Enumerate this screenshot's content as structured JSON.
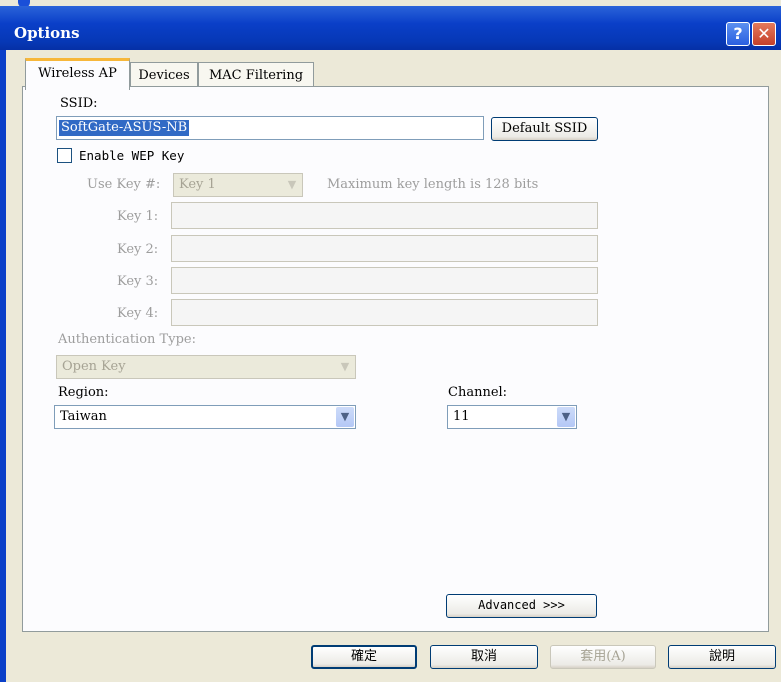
{
  "window": {
    "title": "Options",
    "help_glyph": "?",
    "close_glyph": "✕"
  },
  "tabs": [
    {
      "label": "Wireless AP",
      "active": true
    },
    {
      "label": "Devices",
      "active": false
    },
    {
      "label": "MAC Filtering",
      "active": false
    }
  ],
  "ssid": {
    "label": "SSID:",
    "value": "SoftGate-ASUS-NB",
    "default_button": "Default SSID"
  },
  "wep": {
    "checkbox_label": "Enable WEP Key",
    "checked": false,
    "use_key_label": "Use Key #:",
    "use_key_value": "Key 1",
    "max_length_note": "Maximum key length is 128 bits",
    "keys": [
      {
        "label": "Key 1:",
        "value": ""
      },
      {
        "label": "Key 2:",
        "value": ""
      },
      {
        "label": "Key 3:",
        "value": ""
      },
      {
        "label": "Key 4:",
        "value": ""
      }
    ]
  },
  "auth": {
    "label": "Authentication Type:",
    "value": "Open Key"
  },
  "region": {
    "label": "Region:",
    "value": "Taiwan"
  },
  "channel": {
    "label": "Channel:",
    "value": "11"
  },
  "advanced_button": "Advanced >>>",
  "footer": {
    "ok": "確定",
    "cancel": "取消",
    "apply": "套用(A)",
    "help": "說明"
  },
  "colors": {
    "title_bar": "#0a3fc8",
    "selection": "#316ac5",
    "dialog_bg": "#ece9d8",
    "active_tab_accent": "#f7b73a"
  }
}
